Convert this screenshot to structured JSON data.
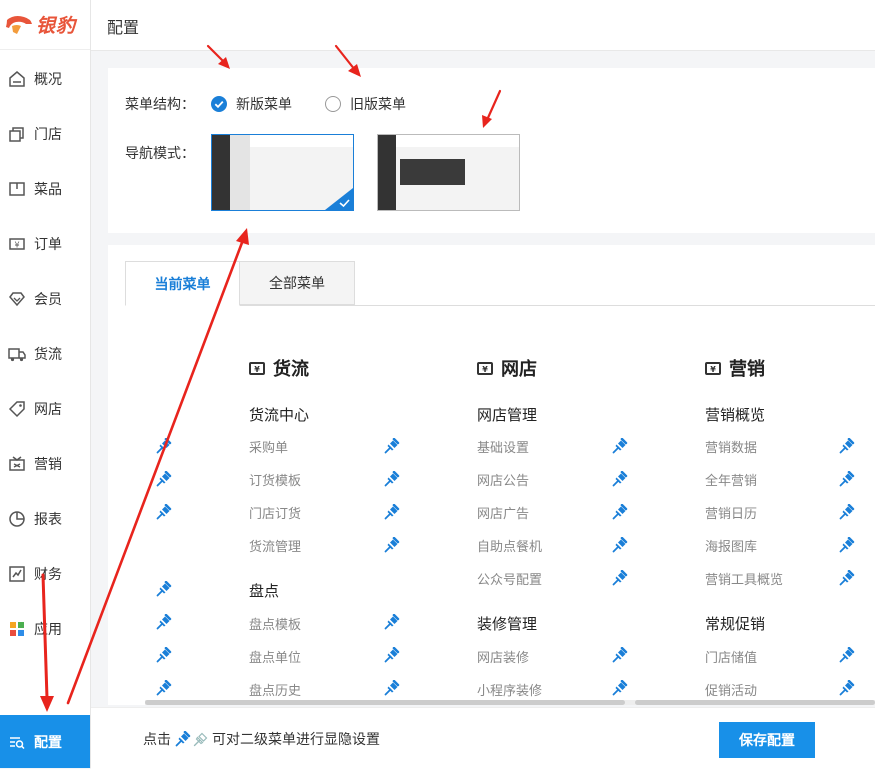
{
  "brand": {
    "name": "银豹",
    "accent": "#e8553a"
  },
  "sidebar": {
    "items": [
      {
        "label": "概况",
        "icon": "home-icon"
      },
      {
        "label": "门店",
        "icon": "store-icon"
      },
      {
        "label": "菜品",
        "icon": "dish-icon"
      },
      {
        "label": "订单",
        "icon": "order-icon"
      },
      {
        "label": "会员",
        "icon": "member-icon"
      },
      {
        "label": "货流",
        "icon": "truck-icon"
      },
      {
        "label": "网店",
        "icon": "tag-icon"
      },
      {
        "label": "营销",
        "icon": "marketing-icon"
      },
      {
        "label": "报表",
        "icon": "pie-chart-icon"
      },
      {
        "label": "财务",
        "icon": "finance-icon"
      },
      {
        "label": "应用",
        "icon": "apps-icon"
      }
    ],
    "active_item": {
      "label": "配置",
      "icon": "config-icon"
    }
  },
  "header": {
    "title": "配置"
  },
  "config": {
    "menu_structure_label": "菜单结构：",
    "option_new": "新版菜单",
    "option_old": "旧版菜单",
    "nav_mode_label": "导航模式："
  },
  "tabs": {
    "current": "当前菜单",
    "all": "全部菜单"
  },
  "columns": [
    {
      "title": "货流",
      "sections": [
        {
          "title": "货流中心",
          "items": [
            "采购单",
            "订货模板",
            "门店订货",
            "货流管理"
          ]
        },
        {
          "title": "盘点",
          "items": [
            "盘点模板",
            "盘点单位",
            "盘点历史"
          ]
        }
      ]
    },
    {
      "title": "网店",
      "sections": [
        {
          "title": "网店管理",
          "items": [
            "基础设置",
            "网店公告",
            "网店广告",
            "自助点餐机",
            "公众号配置"
          ]
        },
        {
          "title": "装修管理",
          "items": [
            "网店装修",
            "小程序装修"
          ]
        }
      ]
    },
    {
      "title": "营销",
      "sections": [
        {
          "title": "营销概览",
          "items": [
            "营销数据",
            "全年营销",
            "营销日历",
            "海报图库",
            "营销工具概览"
          ]
        },
        {
          "title": "常规促销",
          "items": [
            "门店储值",
            "促销活动"
          ]
        }
      ]
    }
  ],
  "footer": {
    "hint_prefix": "点击",
    "hint_suffix": "可对二级菜单进行显隐设置",
    "save_label": "保存配置"
  },
  "colors": {
    "primary": "#1890e8",
    "pin": "#1a7fd8",
    "arrow": "#e8241d"
  }
}
